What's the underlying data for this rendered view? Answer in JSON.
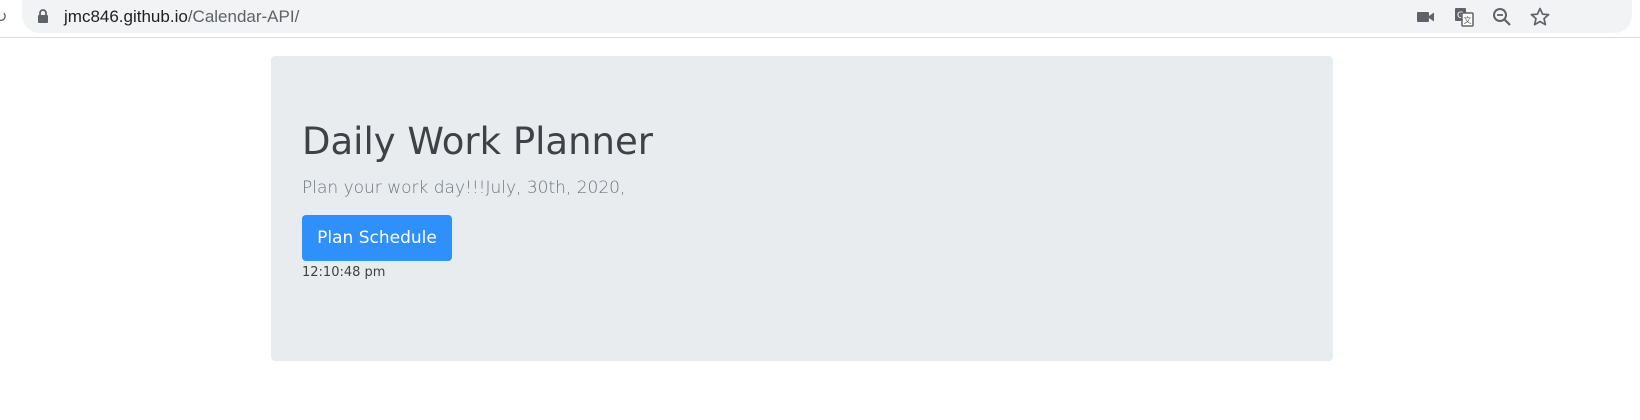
{
  "browser": {
    "url_host": "jmc846.github.io",
    "url_path": "/Calendar-API/",
    "icons": [
      "reload-icon",
      "lock-icon",
      "camera-icon",
      "translate-icon",
      "zoom-out-icon",
      "bookmark-star-icon"
    ]
  },
  "jumbotron": {
    "title": "Daily Work Planner",
    "lead": "Plan your work day!!!July, 30th, 2020,",
    "button_label": "Plan Schedule",
    "time": "12:10:48 pm"
  },
  "colors": {
    "jumbotron_bg": "#e9ecef",
    "button_bg": "#2f8ffb",
    "title_text": "#3d4247",
    "lead_text": "#6c757d"
  }
}
